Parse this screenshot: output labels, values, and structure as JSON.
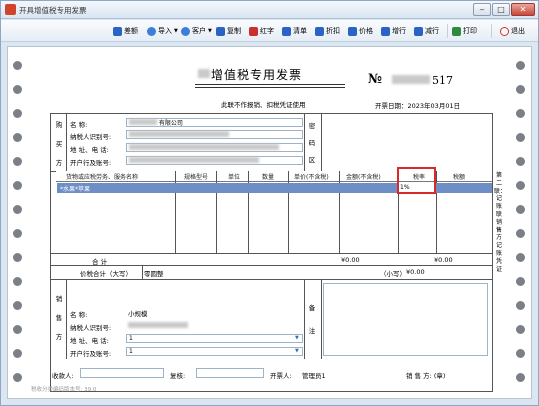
{
  "window": {
    "title": "开具增值税专用发票",
    "minimize": "‒",
    "maximize": "□",
    "close": "✕"
  },
  "toolbar": {
    "items": [
      {
        "label": "差额",
        "icon": "difference-icon",
        "color": "#2a63c4"
      },
      {
        "label": "导入",
        "icon": "import-icon",
        "color": "#3d7ed8"
      },
      {
        "label": "客户",
        "icon": "customer-icon",
        "color": "#3d7ed8"
      },
      {
        "label": "复制",
        "icon": "copy-icon",
        "color": "#2a63c4"
      },
      {
        "label": "红字",
        "icon": "red-letter-icon",
        "color": "#c9302c"
      },
      {
        "label": "清单",
        "icon": "list-icon",
        "color": "#2a63c4"
      },
      {
        "label": "折扣",
        "icon": "discount-icon",
        "color": "#2a63c4"
      },
      {
        "label": "价格",
        "icon": "price-icon",
        "color": "#2a63c4"
      },
      {
        "label": "增行",
        "icon": "add-row-icon",
        "color": "#2a63c4"
      },
      {
        "label": "减行",
        "icon": "remove-row-icon",
        "color": "#2a63c4"
      },
      {
        "label": "打印",
        "icon": "print-icon",
        "color": "#2e8b3d"
      },
      {
        "label": "退出",
        "icon": "exit-icon",
        "color": "#c9302c"
      }
    ]
  },
  "invoice": {
    "title": "增值税专用发票",
    "subtitle": "此联不作报销、扣税凭证使用",
    "number_label": "№",
    "number_suffix": "517",
    "date_label": "开票日期：",
    "date_value": "2023年03月01日",
    "buyer": {
      "side_label": [
        "购",
        "买",
        "方"
      ],
      "name_label": "名        称:",
      "name_value": "有限公司",
      "tax_id_label": "纳税人识别号:",
      "address_label": "地 址、电 话:",
      "bank_label": "开户行及账号:"
    },
    "password_label": [
      "密",
      "码",
      "区"
    ],
    "columns": [
      "货物或应税劳务、服务名称",
      "规格型号",
      "单位",
      "数量",
      "单价(不含税)",
      "金额(不含税)",
      "税率",
      "税额"
    ],
    "rows": [
      {
        "name": "*水果*苹果",
        "tax_rate": "1%"
      }
    ],
    "total_label": "合        计",
    "total_amount": "¥0.00",
    "total_tax": "¥0.00",
    "grand_total_label": "价税合计（大写）",
    "grand_total_upper": "零圆整",
    "grand_total_lower_label": "（小写）",
    "grand_total_lower": "¥0.00",
    "seller": {
      "side_label": [
        "销",
        "售",
        "方"
      ],
      "name_label": "名        称:",
      "name_value": "小规模",
      "tax_id_label": "纳税人识别号:",
      "address_label": "地 址、电 话:",
      "address_value": "1",
      "bank_label": "开户行及账号:",
      "bank_value": "1"
    },
    "remarks_label": [
      "备",
      "注"
    ],
    "payee_label": "收款人:",
    "reviewer_label": "复核:",
    "issuer_label": "开票人:",
    "issuer_value": "管理员1",
    "seller_seal_label": "销  售  方:  (章)",
    "side_note": "第二联：记账联 销售方记账凭证",
    "footnote": "税收分类编码版本号: 39.0"
  }
}
